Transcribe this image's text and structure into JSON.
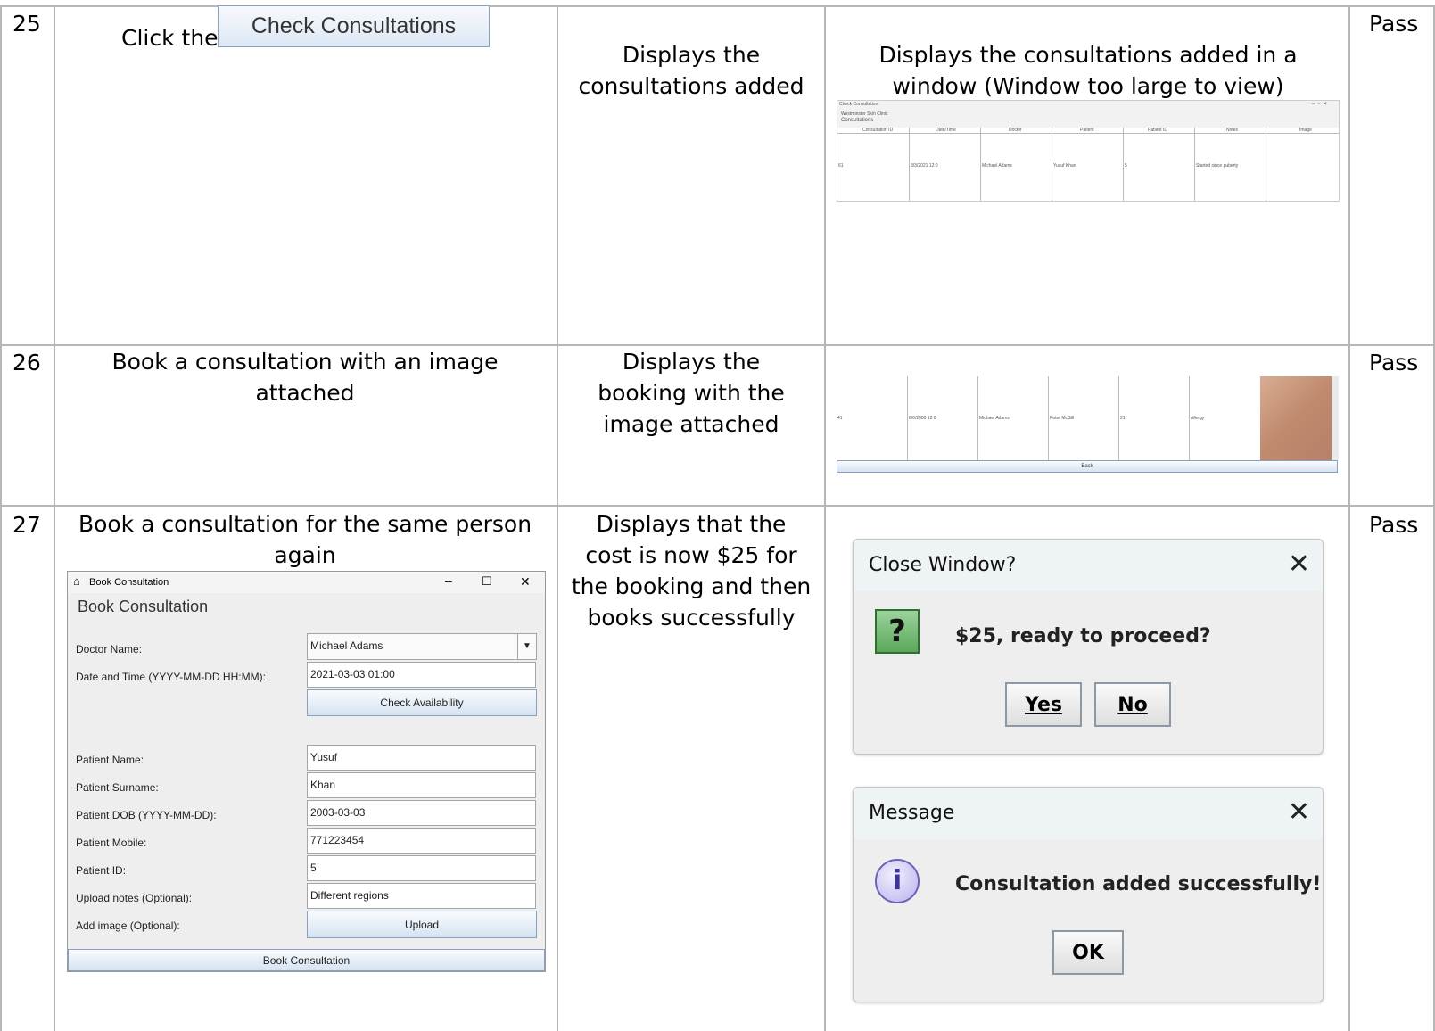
{
  "rows": [
    {
      "num": "25",
      "action_prefix": "Click the",
      "action_button": "Check Consultations",
      "expected": "Displays the consultations added",
      "actual": "Displays the consultations added in a window (Window too large to view)",
      "result": "Pass"
    },
    {
      "num": "26",
      "action": "Book a consultation with an image attached",
      "expected": "Displays the booking with the image attached",
      "result": "Pass"
    },
    {
      "num": "27",
      "action": "Book a consultation for the same person again",
      "expected": "Displays that the cost is now $25 for the booking and then books successfully",
      "result": "Pass"
    }
  ],
  "check_window": {
    "title": "Check Consultation",
    "subtitle": "Westminster Skin Clinic",
    "heading": "Consultations",
    "columns": [
      "Consultation ID",
      "Date/Time",
      "Doctor",
      "Patient",
      "Patient ID",
      "Notes",
      "Image"
    ],
    "row": [
      "61",
      "3/3/2021 12:0",
      "Michael Adams",
      "Yusuf Khan",
      "5",
      "Started since puberty",
      ""
    ]
  },
  "image_window": {
    "row": [
      "41",
      "6/6/2000 12:0",
      "Michael Adams",
      "Peter McGill",
      "21",
      "Allergy"
    ],
    "back_label": "Back"
  },
  "book_window": {
    "title": "Book Consultation",
    "heading": "Book Consultation",
    "doctor_label": "Doctor Name:",
    "doctor_value": "Michael Adams",
    "datetime_label": "Date and Time (YYYY-MM-DD HH:MM):",
    "datetime_value": "2021-03-03 01:00",
    "check_label": "Check Availability",
    "name_label": "Patient Name:",
    "name_value": "Yusuf",
    "surname_label": "Patient Surname:",
    "surname_value": "Khan",
    "dob_label": "Patient DOB (YYYY-MM-DD):",
    "dob_value": "2003-03-03",
    "mobile_label": "Patient Mobile:",
    "mobile_value": "771223454",
    "id_label": "Patient ID:",
    "id_value": "5",
    "notes_label": "Upload notes (Optional):",
    "notes_value": "Different regions",
    "image_label": "Add image (Optional):",
    "upload_label": "Upload",
    "book_label": "Book Consultation"
  },
  "confirm_dialog": {
    "title": "Close Window?",
    "message": "$25, ready to proceed?",
    "yes": "Yes",
    "no": "No"
  },
  "message_dialog": {
    "title": "Message",
    "message": "Consultation added successfully!",
    "ok": "OK"
  }
}
